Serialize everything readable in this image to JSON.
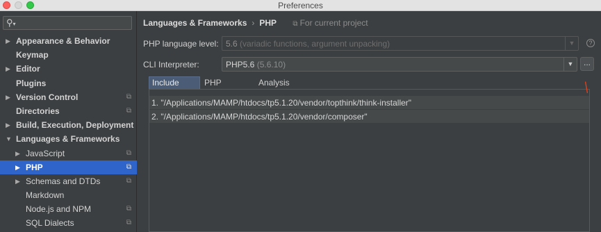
{
  "window": {
    "title": "Preferences"
  },
  "sidebar": {
    "search_placeholder": "",
    "items": [
      {
        "label": "Appearance & Behavior",
        "arrow": "▶",
        "bold": true
      },
      {
        "label": "Keymap",
        "arrow": "",
        "bold": true
      },
      {
        "label": "Editor",
        "arrow": "▶",
        "bold": true
      },
      {
        "label": "Plugins",
        "arrow": "",
        "bold": true
      },
      {
        "label": "Version Control",
        "arrow": "▶",
        "bold": true,
        "project": "⧉"
      },
      {
        "label": "Directories",
        "arrow": "",
        "bold": true,
        "project": "⧉"
      },
      {
        "label": "Build, Execution, Deployment",
        "arrow": "▶",
        "bold": true
      },
      {
        "label": "Languages & Frameworks",
        "arrow": "▼",
        "bold": true
      },
      {
        "label": "JavaScript",
        "arrow": "▶",
        "bold": false,
        "project": "⧉"
      },
      {
        "label": "PHP",
        "arrow": "▶",
        "bold": true,
        "project": "⧉",
        "selected": true
      },
      {
        "label": "Schemas and DTDs",
        "arrow": "▶",
        "bold": false,
        "project": "⧉"
      },
      {
        "label": "Markdown",
        "arrow": "",
        "bold": false
      },
      {
        "label": "Node.js and NPM",
        "arrow": "",
        "bold": false,
        "project": "⧉"
      },
      {
        "label": "SQL Dialects",
        "arrow": "",
        "bold": false,
        "project": "⧉"
      }
    ]
  },
  "breadcrumb": {
    "parent": "Languages & Frameworks",
    "separator": "›",
    "current": "PHP",
    "scope_icon": "⧉",
    "scope": "For current project"
  },
  "php_level": {
    "label": "PHP language level:",
    "value": "5.6",
    "detail": "(variadic functions, argument unpacking)"
  },
  "cli": {
    "label": "CLI Interpreter:",
    "value": "PHP5.6",
    "detail": "(5.6.10)",
    "more": "..."
  },
  "help_icon": "?",
  "dropdown_icon": "▼",
  "tabs": [
    "Include Path",
    "PHP Runtime",
    "Analysis"
  ],
  "include_paths": [
    "1. \"/Applications/MAMP/htdocs/tp5.1.20/vendor/topthink/think-installer\"",
    "2. \"/Applications/MAMP/htdocs/tp5.1.20/vendor/composer\""
  ],
  "colors": {
    "accent": "#2f65ca",
    "background": "#3c3f41",
    "tab_active": "#4b5d76",
    "marker": "#e0401c"
  }
}
